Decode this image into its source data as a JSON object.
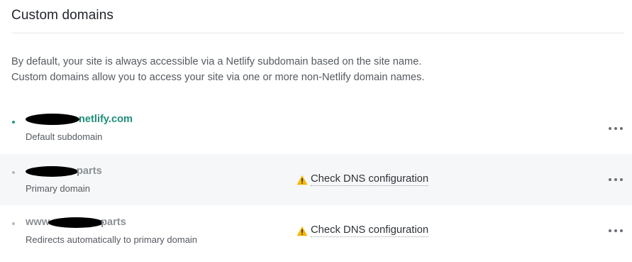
{
  "section": {
    "title": "Custom domains",
    "description": [
      "By default, your site is always accessible via a Netlify subdomain based on the site name.",
      "Custom domains allow you to access your site via one or more non-Netlify domain names."
    ]
  },
  "domains": [
    {
      "prefix": "",
      "suffix": "netlify.com",
      "subtitle": "Default subdomain",
      "status": null,
      "is_link": true,
      "icon": "more-options-icon"
    },
    {
      "prefix": "",
      "suffix": "parts",
      "subtitle": "Primary domain",
      "status": "Check DNS configuration",
      "is_link": false,
      "icon": "more-options-icon"
    },
    {
      "prefix": "www",
      "suffix": "parts",
      "subtitle": "Redirects automatically to primary domain",
      "status": "Check DNS configuration",
      "is_link": false,
      "icon": "more-options-icon"
    }
  ],
  "colors": {
    "link": "#1f8f7a",
    "warning": "#f5b700",
    "row_shade": "#f6f7f8"
  }
}
